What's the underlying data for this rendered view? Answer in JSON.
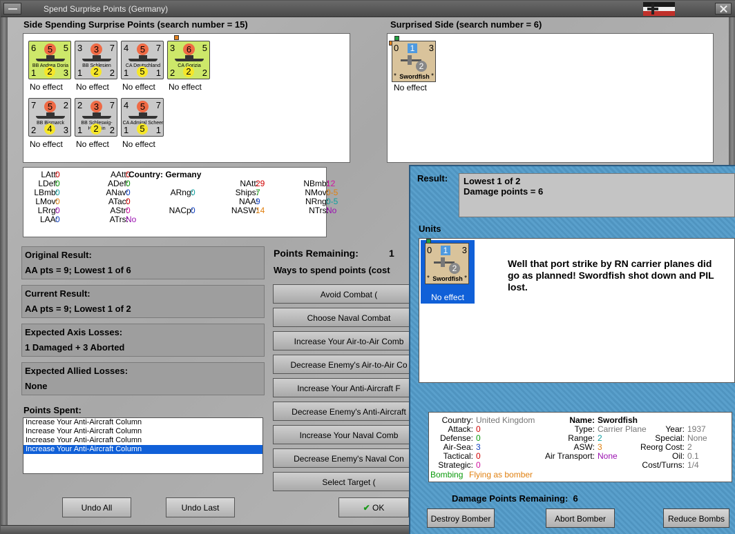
{
  "window": {
    "title": "Spend Surprise Points (Germany)"
  },
  "spending": {
    "header": "Side Spending Surprise Points (search number = 15)",
    "units": [
      {
        "tl": "6",
        "mid": "5",
        "tr": "5",
        "name": "BB Andrea Doria",
        "bl": "1",
        "bm": "2",
        "br": "3",
        "effect": "No effect",
        "color": "green"
      },
      {
        "tl": "3",
        "mid": "3",
        "tr": "7",
        "name": "BB Schlesien",
        "bl": "1",
        "bm": "2",
        "br": "2",
        "effect": "No effect",
        "color": "gray"
      },
      {
        "tl": "4",
        "mid": "5",
        "tr": "7",
        "name": "CA Deutschland",
        "bl": "1",
        "bm": "5",
        "br": "1",
        "effect": "No effect",
        "color": "gray"
      },
      {
        "tl": "3",
        "mid": "6",
        "tr": "5",
        "name": "CA Gorizia",
        "bl": "2",
        "bm": "2",
        "br": "2",
        "effect": "No effect",
        "color": "green"
      },
      {
        "tl": "7",
        "mid": "5",
        "tr": "2",
        "name": "BB Bismarck",
        "bl": "2",
        "bm": "4",
        "br": "3",
        "effect": "No effect",
        "color": "gray"
      },
      {
        "tl": "2",
        "mid": "3",
        "tr": "7",
        "name": "BB Schleswig-Holstein",
        "bl": "1",
        "bm": "2",
        "br": "2",
        "effect": "No effect",
        "color": "gray"
      },
      {
        "tl": "4",
        "mid": "5",
        "tr": "7",
        "name": "CA Admiral Scheer",
        "bl": "1",
        "bm": "5",
        "br": "1",
        "effect": "No effect",
        "color": "gray"
      }
    ]
  },
  "surprised": {
    "header": "Surprised Side (search number = 6)",
    "unit": {
      "tl": "0",
      "blue": "1",
      "tr": "3",
      "gray": "2",
      "name": "Swordfish",
      "effect": "No effect"
    }
  },
  "country_stats": {
    "country_label": "Country:",
    "country": "Germany",
    "cols": [
      [
        [
          "LAtt:",
          "0",
          "red"
        ],
        [
          "LDef:",
          "0",
          "grn"
        ],
        [
          "LBmb:",
          "0",
          "teal"
        ],
        [
          "LMov:",
          "0",
          "org"
        ],
        [
          "LRrg:",
          "0",
          "pur"
        ],
        [
          "LAA:",
          "0",
          "blu"
        ]
      ],
      [
        [
          "AAtt:",
          "0",
          "red"
        ],
        [
          "ADef:",
          "0",
          "grn"
        ],
        [
          "ANav:",
          "0",
          "blu"
        ],
        [
          "ATac:",
          "0",
          "red"
        ],
        [
          "AStr:",
          "0",
          "mag"
        ],
        [
          "ATrs:",
          "No",
          "pur"
        ]
      ],
      [
        [
          "ARng:",
          "0",
          "teal"
        ],
        [
          "NACp:",
          "0",
          "blu"
        ]
      ],
      [
        [
          "NAtt:",
          "29",
          "red"
        ],
        [
          "Ships:",
          "7",
          "grn"
        ],
        [
          "NAA:",
          "9",
          "blu"
        ],
        [
          "NASW:",
          "14",
          "org"
        ]
      ],
      [
        [
          "NBmb:",
          "12",
          "mag"
        ],
        [
          "NMov:",
          "0-5",
          "org"
        ],
        [
          "NRng:",
          "0-5",
          "teal"
        ],
        [
          "NTrs:",
          "No",
          "pur"
        ]
      ]
    ]
  },
  "results": {
    "original_label": "Original Result:",
    "original_value": "AA pts = 9; Lowest 1 of 6",
    "current_label": "Current Result:",
    "current_value": "AA pts = 9; Lowest 1 of 2",
    "axis_label": "Expected Axis Losses:",
    "axis_value": "1 Damaged + 3 Aborted",
    "allied_label": "Expected Allied Losses:",
    "allied_value": "None"
  },
  "points_spent": {
    "label": "Points Spent:",
    "items": [
      "Increase Your Anti-Aircraft Column",
      "Increase Your Anti-Aircraft Column",
      "Increase Your Anti-Aircraft Column",
      "Increase Your Anti-Aircraft Column"
    ]
  },
  "points_remaining": {
    "label": "Points Remaining:",
    "value": "1",
    "ways": "Ways to spend points (cost"
  },
  "ways_buttons": [
    "Avoid Combat (",
    "Choose Naval Combat",
    "Increase Your Air-to-Air Comb",
    "Decrease Enemy's Air-to-Air Co",
    "Increase Your Anti-Aircraft F",
    "Decrease Enemy's Anti-Aircraft",
    "Increase Your Naval Comb",
    "Decrease Enemy's Naval Con",
    "Select Target ("
  ],
  "bottom_buttons": {
    "undo_all": "Undo All",
    "undo_last": "Undo Last",
    "ok": "OK"
  },
  "popup": {
    "result_label": "Result:",
    "result_line1": "Lowest 1 of 2",
    "result_line2": "Damage points = 6",
    "units_label": "Units",
    "unit": {
      "tl": "0",
      "blue": "1",
      "tr": "3",
      "gray": "2",
      "name": "Swordfish",
      "effect": "No effect"
    },
    "note": "Well that port strike by RN carrier planes did go as planned!  Swordfish shot down and PIL lost.",
    "info": {
      "country_label": "Country:",
      "country": "United Kingdom",
      "attack_label": "Attack:",
      "attack": "0",
      "defense_label": "Defense:",
      "defense": "0",
      "airsea_label": "Air-Sea:",
      "airsea": "3",
      "tactical_label": "Tactical:",
      "tactical": "0",
      "strategic_label": "Strategic:",
      "strategic": "0",
      "name_label": "Name:",
      "name": "Swordfish",
      "type_label": "Type:",
      "type": "Carrier Plane",
      "range_label": "Range:",
      "range": "2",
      "asw_label": "ASW:",
      "asw": "3",
      "airtransport_label": "Air Transport:",
      "airtransport": "None",
      "year_label": "Year:",
      "year": "1937",
      "special_label": "Special:",
      "special": "None",
      "reorg_label": "Reorg Cost:",
      "reorg": "2",
      "oil_label": "Oil:",
      "oil": "0.1",
      "costturns_label": "Cost/Turns:",
      "costturns": "1/4",
      "bombing": "Bombing",
      "flying": "Flying as bomber"
    },
    "dmg_label": "Damage Points Remaining:",
    "dmg_value": "6",
    "btn_destroy": "Destroy Bomber",
    "btn_abort": "Abort Bomber",
    "btn_reduce": "Reduce Bombs"
  }
}
